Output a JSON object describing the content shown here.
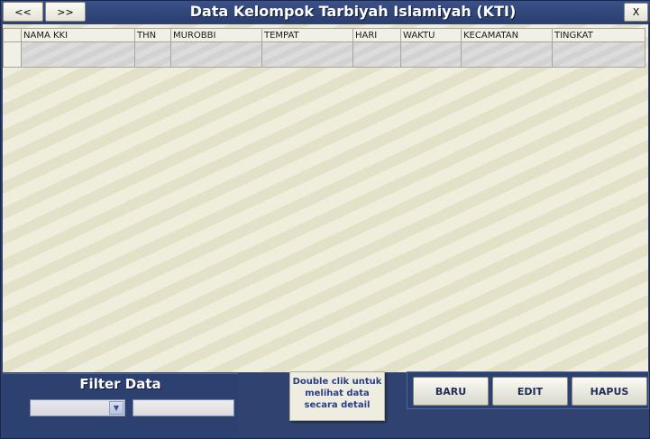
{
  "window": {
    "title": "Data Kelompok Tarbiyah Islamiyah (KTI)",
    "prev_label": "<<",
    "next_label": ">>",
    "close_label": "X"
  },
  "grid": {
    "columns": [
      "NAMA KKI",
      "THN",
      "MUROBBI",
      "TEMPAT",
      "HARI",
      "WAKTU",
      "KECAMATAN",
      "TINGKAT"
    ],
    "rows": [
      [
        "",
        "",
        "",
        "",
        "",
        "",
        "",
        ""
      ]
    ]
  },
  "filter": {
    "title": "Filter Data",
    "field_value": "",
    "search_value": ""
  },
  "hint": {
    "text": "Double clik untuk\nmelihat data\nsecara detail"
  },
  "actions": {
    "new_label": "BARU",
    "edit_label": "EDIT",
    "delete_label": "HAPUS"
  },
  "icons": {
    "select_arrow": "chevron-down-icon"
  },
  "colors": {
    "frame": "#2f4270",
    "content_bg": "#ecead6",
    "hint_text": "#2b3e88",
    "title_text": "#ffffff"
  }
}
